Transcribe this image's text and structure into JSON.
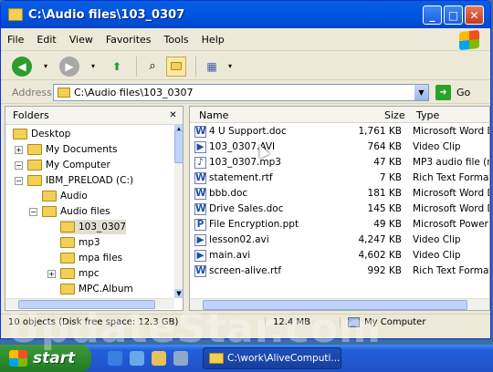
{
  "window": {
    "title": "C:\\Audio files\\103_0307",
    "buttons": {
      "minimize": "_",
      "maximize": "□",
      "close": "✕"
    }
  },
  "menu": [
    "File",
    "Edit",
    "View",
    "Favorites",
    "Tools",
    "Help"
  ],
  "toolbar": {
    "icons": [
      "back-icon",
      "forward-icon",
      "up-folder-icon",
      "search-icon",
      "folders-icon",
      "views-icon"
    ],
    "colors": {
      "back": "#2e9c2e",
      "forward": "#a8a8a8"
    }
  },
  "address": {
    "label": "Address",
    "value": "C:\\Audio files\\103_0307",
    "go_label": "Go"
  },
  "folders": {
    "header": "Folders",
    "close": "✕",
    "nodes": [
      {
        "label": "Desktop",
        "depth": 0,
        "expander": ""
      },
      {
        "label": "My Documents",
        "depth": 1,
        "expander": "+"
      },
      {
        "label": "My Computer",
        "depth": 1,
        "expander": "−"
      },
      {
        "label": "IBM_PRELOAD (C:)",
        "depth": 2,
        "expander": "−"
      },
      {
        "label": "Audio",
        "depth": 3,
        "expander": ""
      },
      {
        "label": "Audio files",
        "depth": 3,
        "expander": "−"
      },
      {
        "label": "103_0307",
        "depth": 4,
        "expander": "",
        "selected": true
      },
      {
        "label": "mp3",
        "depth": 4,
        "expander": ""
      },
      {
        "label": "mpa files",
        "depth": 4,
        "expander": ""
      },
      {
        "label": "mpc",
        "depth": 4,
        "expander": "+"
      },
      {
        "label": "MPC.Album",
        "depth": 4,
        "expander": ""
      }
    ]
  },
  "files": {
    "columns": {
      "name": "Name",
      "size": "Size",
      "type": "Type"
    },
    "rows": [
      {
        "name": "4 U Support.doc",
        "size": "1,761 KB",
        "type": "Microsoft Word D",
        "icon": "word-doc-icon"
      },
      {
        "name": "103_0307.AVI",
        "size": "764 KB",
        "type": "Video Clip",
        "icon": "video-clip-icon"
      },
      {
        "name": "103_0307.mp3",
        "size": "47 KB",
        "type": "MP3 audio file (m",
        "icon": "audio-file-icon"
      },
      {
        "name": "statement.rtf",
        "size": "7 KB",
        "type": "Rich Text Format",
        "icon": "rtf-doc-icon"
      },
      {
        "name": "bbb.doc",
        "size": "181 KB",
        "type": "Microsoft Word D",
        "icon": "word-doc-icon"
      },
      {
        "name": "Drive Sales.doc",
        "size": "145 KB",
        "type": "Microsoft Word D",
        "icon": "word-doc-icon"
      },
      {
        "name": "File Encryption.ppt",
        "size": "49 KB",
        "type": "Microsoft Power",
        "icon": "ppt-doc-icon"
      },
      {
        "name": "lesson02.avi",
        "size": "4,247 KB",
        "type": "Video Clip",
        "icon": "video-clip-icon"
      },
      {
        "name": "main.avi",
        "size": "4,602 KB",
        "type": "Video Clip",
        "icon": "video-clip-icon"
      },
      {
        "name": "screen-alive.rtf",
        "size": "992 KB",
        "type": "Rich Text Format",
        "icon": "rtf-doc-icon"
      }
    ]
  },
  "status": {
    "objects": "10 objects (Disk free space: 12.3 GB)",
    "size": "12.4 MB",
    "location": "My Computer"
  },
  "taskbar": {
    "start": "start",
    "task": "C:\\work\\AliveComputi..."
  },
  "watermark": "UpdateStar.com"
}
